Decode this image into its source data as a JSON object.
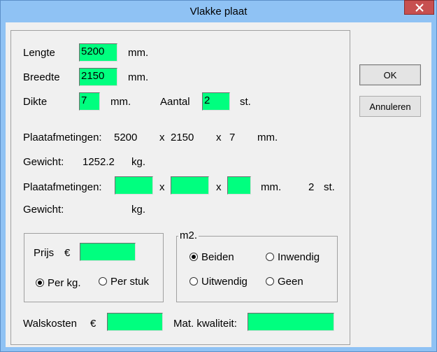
{
  "window": {
    "title": "Vlakke plaat"
  },
  "fields": {
    "lengte": {
      "label": "Lengte",
      "value": "5200",
      "unit": "mm."
    },
    "breedte": {
      "label": "Breedte",
      "value": "2150",
      "unit": "mm."
    },
    "dikte": {
      "label": "Dikte",
      "value": "7",
      "unit": "mm."
    },
    "aantal": {
      "label": "Aantal",
      "value": "2",
      "unit": "st."
    }
  },
  "summary1": {
    "label": "Plaatafmetingen:",
    "length": "5200",
    "x1": "x",
    "width": "2150",
    "x2": "x",
    "thickness": "7",
    "unit": "mm.",
    "weight_label": "Gewicht:",
    "weight_value": "1252.2",
    "weight_unit": "kg."
  },
  "summary2": {
    "label": "Plaatafmetingen:",
    "x1": "x",
    "x2": "x",
    "unit": "mm.",
    "count": "2",
    "count_unit": "st.",
    "dim1": "",
    "dim2": "",
    "dim3": "",
    "weight_label": "Gewicht:",
    "weight_unit": "kg."
  },
  "price_group": {
    "prijs_label": "Prijs",
    "currency": "€",
    "prijs_value": "",
    "option_kg": "Per kg.",
    "option_stuk": "Per stuk",
    "selected": "Per kg."
  },
  "m2_group": {
    "title": "m2.",
    "options": [
      "Beiden",
      "Inwendig",
      "Uitwendig",
      "Geen"
    ],
    "selected": "Beiden"
  },
  "bottom": {
    "walskosten_label": "Walskosten",
    "currency": "€",
    "walskosten_value": "",
    "mat_label": "Mat. kwaliteit:",
    "mat_value": ""
  },
  "buttons": {
    "ok": "OK",
    "cancel": "Annuleren"
  },
  "colors": {
    "input_bg": "#00ff7f",
    "titlebar": "#8fc2f4",
    "close": "#c75050"
  }
}
